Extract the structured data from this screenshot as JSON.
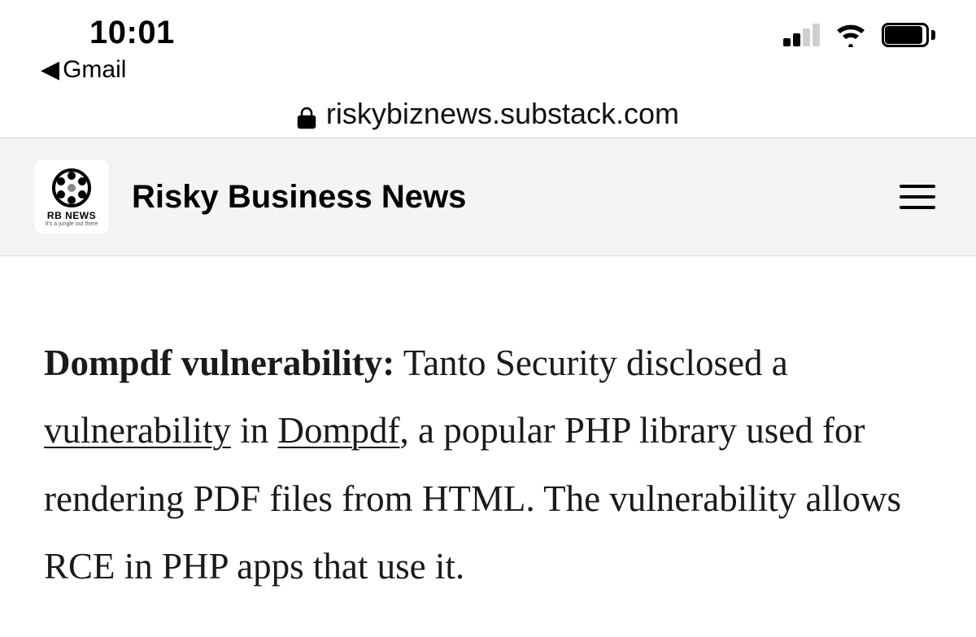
{
  "status": {
    "time": "10:01",
    "back_app": "Gmail",
    "cell_bars_active": 2,
    "wifi": true,
    "battery_pct": 90
  },
  "browser": {
    "url": "riskybiznews.substack.com"
  },
  "site_header": {
    "title": "Risky Business News",
    "logo_label_1": "RB NEWS",
    "logo_label_2": "It's a jungle out there"
  },
  "article": {
    "lead_bold": "Dompdf vulnerability:",
    "t1": " Tanto Security disclosed a ",
    "link1": "vulnerability",
    "t2": " in ",
    "link2": "Dompdf",
    "t3": ", a popular PHP library used for rendering PDF files from HTML. The vulnerability allows RCE in PHP apps that use it."
  }
}
